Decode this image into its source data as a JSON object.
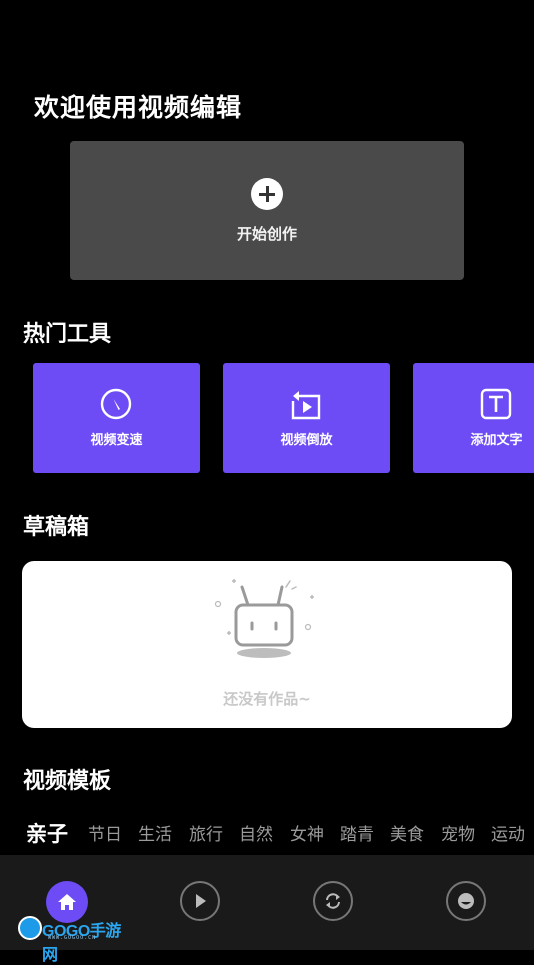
{
  "welcome_title": "欢迎使用视频编辑",
  "create": {
    "label": "开始创作",
    "icon": "plus-circle-icon"
  },
  "hot_tools": {
    "title": "热门工具",
    "items": [
      {
        "label": "视频变速",
        "icon": "speed-dial-icon"
      },
      {
        "label": "视频倒放",
        "icon": "reverse-play-icon"
      },
      {
        "label": "添加文字",
        "icon": "text-box-icon"
      }
    ]
  },
  "drafts": {
    "title": "草稿箱",
    "empty_text": "还没有作品~",
    "icon": "empty-tv-icon"
  },
  "templates": {
    "title": "视频模板",
    "tabs": [
      "亲子",
      "节日",
      "生活",
      "旅行",
      "自然",
      "女神",
      "踏青",
      "美食",
      "宠物",
      "运动"
    ],
    "active_tab": "亲子"
  },
  "bottom_nav": {
    "items": [
      {
        "icon": "home-icon",
        "active": true
      },
      {
        "icon": "play-icon",
        "active": false
      },
      {
        "icon": "refresh-icon",
        "active": false
      },
      {
        "icon": "face-icon",
        "active": false
      }
    ]
  },
  "watermark": {
    "text": "GOGO手游网",
    "sub": "WWW.GOGOO.CN"
  },
  "colors": {
    "accent": "#6d4cf6",
    "background": "#000000",
    "card": "#4a4a4a"
  }
}
